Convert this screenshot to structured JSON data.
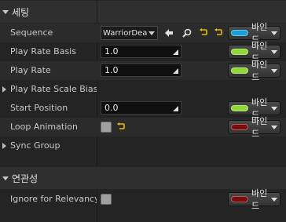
{
  "sections": {
    "settings_title": "세팅",
    "relevancy_title": "연관성"
  },
  "rows": {
    "sequence": {
      "label": "Sequence",
      "value": "WarriorDeath"
    },
    "play_rate_basis": {
      "label": "Play Rate Basis",
      "value": "1.0"
    },
    "play_rate": {
      "label": "Play Rate",
      "value": "1.0"
    },
    "play_rate_scale_bias": {
      "label": "Play Rate Scale Bias Clamp"
    },
    "start_position": {
      "label": "Start Position",
      "value": "0.0"
    },
    "loop_animation": {
      "label": "Loop Animation",
      "checked": false
    },
    "sync_group": {
      "label": "Sync Group"
    },
    "ignore_relevancy": {
      "label": "Ignore for Relevancy Test",
      "checked": false
    }
  },
  "bind_label": "바인드",
  "colors": {
    "pin_blue": "#1aa0d8",
    "pin_green": "#8fd83a",
    "pin_red": "#7a0c0c",
    "reset_yellow": "#e8c000"
  },
  "icons": {
    "browse": "left-arrow-icon",
    "find": "magnifier-icon",
    "reset": "reset-arrow-icon"
  }
}
